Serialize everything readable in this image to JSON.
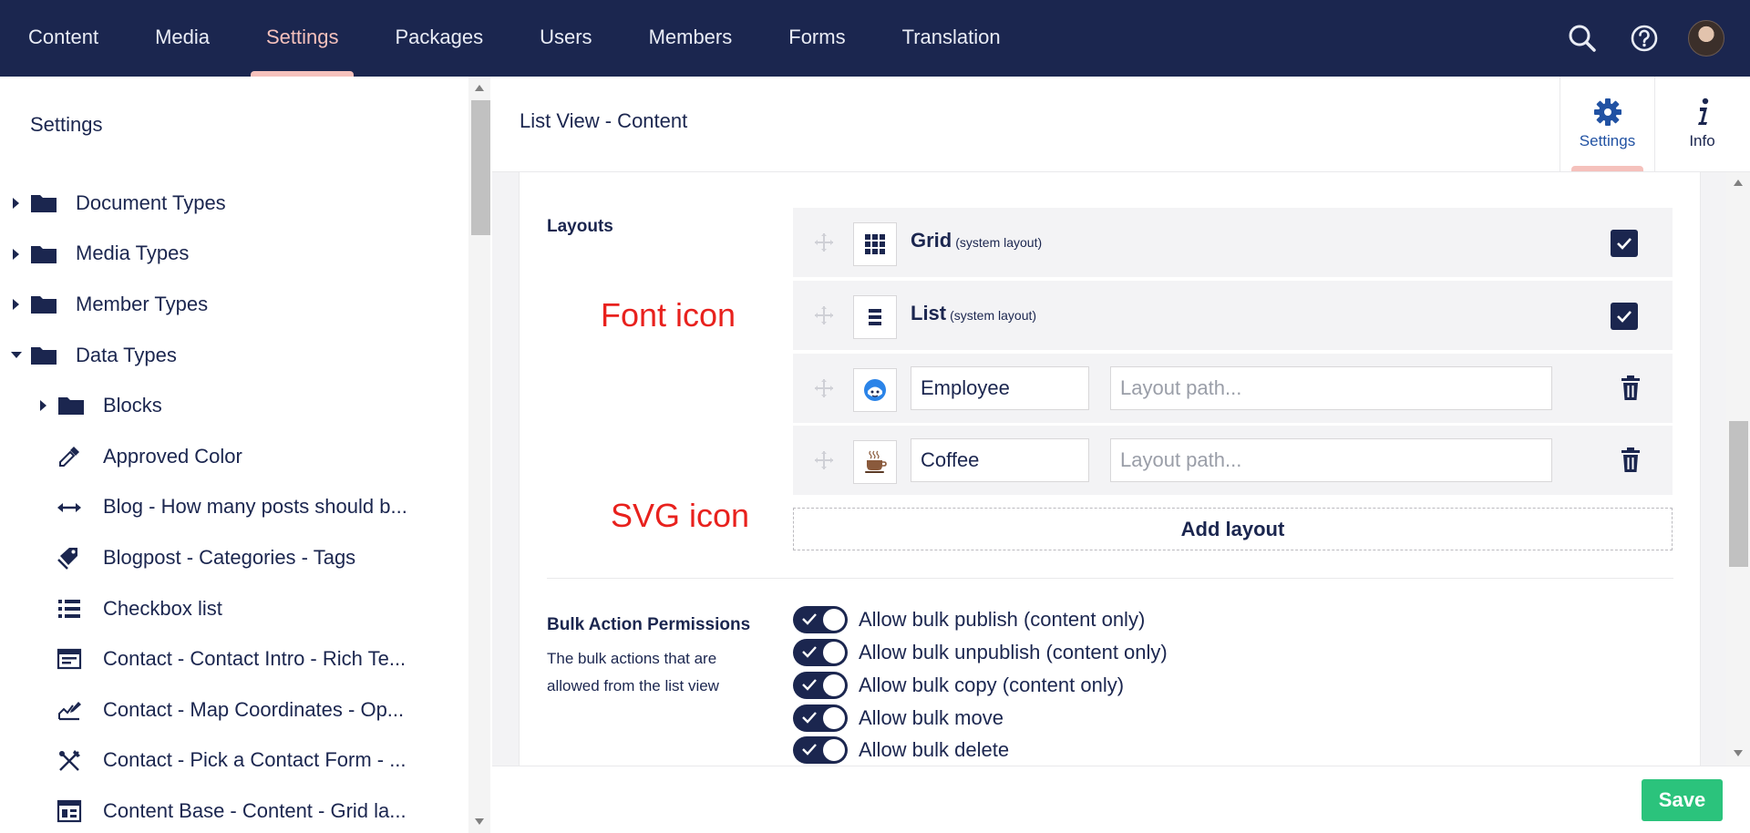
{
  "nav": {
    "items": [
      "Content",
      "Media",
      "Settings",
      "Packages",
      "Users",
      "Members",
      "Forms",
      "Translation"
    ],
    "active": "Settings"
  },
  "sidebar": {
    "title": "Settings",
    "items": [
      {
        "label": "Document Types",
        "type": "folder",
        "caret": "right",
        "level": 0
      },
      {
        "label": "Media Types",
        "type": "folder",
        "caret": "right",
        "level": 0
      },
      {
        "label": "Member Types",
        "type": "folder",
        "caret": "right",
        "level": 0
      },
      {
        "label": "Data Types",
        "type": "folder",
        "caret": "down",
        "level": 0
      },
      {
        "label": "Blocks",
        "type": "folder",
        "caret": "right",
        "level": 1
      },
      {
        "label": "Approved Color",
        "type": "eyedropper-icon",
        "level": 1
      },
      {
        "label": "Blog - How many posts should b...",
        "type": "arrows-horizontal-icon",
        "level": 1
      },
      {
        "label": "Blogpost - Categories - Tags",
        "type": "tags-icon",
        "level": 1
      },
      {
        "label": "Checkbox list",
        "type": "list-icon",
        "level": 1
      },
      {
        "label": "Contact - Contact Intro - Rich Te...",
        "type": "rich-text-icon",
        "level": 1
      },
      {
        "label": "Contact - Map Coordinates - Op...",
        "type": "map-edit-icon",
        "level": 1
      },
      {
        "label": "Contact - Pick a Contact Form - ...",
        "type": "tools-icon",
        "level": 1
      },
      {
        "label": "Content Base - Content - Grid la...",
        "type": "grid-layout-icon",
        "level": 1
      }
    ]
  },
  "header": {
    "title": "List View - Content",
    "tabs": [
      {
        "label": "Settings",
        "icon": "gear-icon",
        "active": true
      },
      {
        "label": "Info",
        "icon": "info-icon",
        "active": false
      }
    ]
  },
  "layouts": {
    "label": "Layouts",
    "rows": [
      {
        "name": "Grid",
        "suffix": "(system layout)",
        "icon": "grid-icon",
        "checked": true
      },
      {
        "name": "List",
        "suffix": "(system layout)",
        "icon": "list-lines-icon",
        "checked": true
      },
      {
        "name": "Employee",
        "placeholder": "Layout path...",
        "icon": "face-icon"
      },
      {
        "name": "Coffee",
        "placeholder": "Layout path...",
        "icon": "coffee-icon"
      }
    ],
    "add_label": "Add layout"
  },
  "annotations": {
    "font_icon": "Font icon",
    "svg_icon": "SVG icon"
  },
  "bulk": {
    "label": "Bulk Action Permissions",
    "description": "The bulk actions that are allowed from the list view",
    "toggles": [
      {
        "label": "Allow bulk publish (content only)",
        "on": true
      },
      {
        "label": "Allow bulk unpublish (content only)",
        "on": true
      },
      {
        "label": "Allow bulk copy (content only)",
        "on": true
      },
      {
        "label": "Allow bulk move",
        "on": true
      },
      {
        "label": "Allow bulk delete",
        "on": true
      }
    ]
  },
  "footer": {
    "save_label": "Save"
  },
  "colors": {
    "navy": "#1b264f",
    "accent_pink": "#f5c1bc",
    "save_green": "#2bc37c",
    "annotation_red": "#e8211d"
  }
}
